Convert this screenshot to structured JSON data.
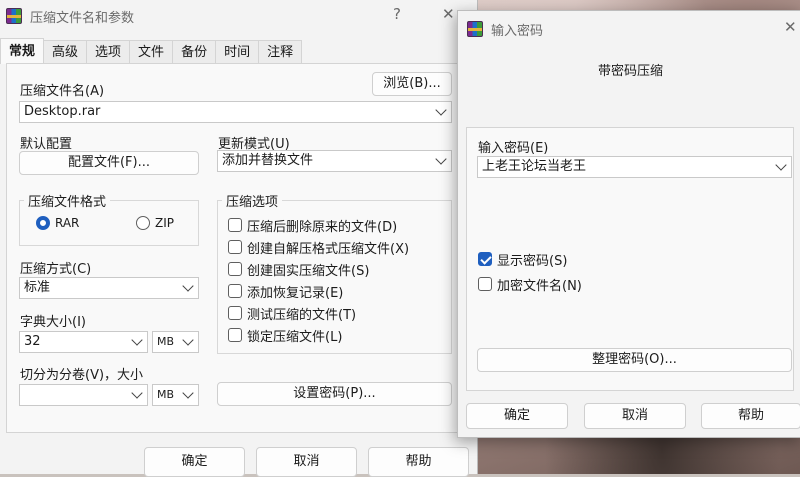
{
  "main_dialog": {
    "title": "压缩文件名和参数",
    "help_glyph": "?",
    "close_glyph": "✕",
    "tabs": [
      "常规",
      "高级",
      "选项",
      "文件",
      "备份",
      "时间",
      "注释"
    ],
    "archive_name_label": "压缩文件名(A)",
    "browse_button": "浏览(B)...",
    "archive_name_value": "Desktop.rar",
    "default_profile_label": "默认配置",
    "profile_button": "配置文件(F)...",
    "update_mode_label": "更新模式(U)",
    "update_mode_value": "添加并替换文件",
    "format_group_title": "压缩文件格式",
    "format_rar": "RAR",
    "format_zip": "ZIP",
    "options_group_title": "压缩选项",
    "options": [
      {
        "label": "压缩后删除原来的文件(D)",
        "checked": false
      },
      {
        "label": "创建自解压格式压缩文件(X)",
        "checked": false
      },
      {
        "label": "创建固实压缩文件(S)",
        "checked": false
      },
      {
        "label": "添加恢复记录(E)",
        "checked": false
      },
      {
        "label": "测试压缩的文件(T)",
        "checked": false
      },
      {
        "label": "锁定压缩文件(L)",
        "checked": false
      }
    ],
    "method_label": "压缩方式(C)",
    "method_value": "标准",
    "dict_label": "字典大小(I)",
    "dict_value": "32",
    "dict_unit": "MB",
    "split_label": "切分为分卷(V)，大小",
    "split_value": "",
    "split_unit": "MB",
    "set_password_button": "设置密码(P)...",
    "ok_button": "确定",
    "cancel_button": "取消",
    "help_button": "帮助"
  },
  "password_dialog": {
    "title": "输入密码",
    "close_glyph": "✕",
    "heading": "带密码压缩",
    "enter_password_label": "输入密码(E)",
    "password_value": "上老王论坛当老王",
    "show_password_label": "显示密码(S)",
    "show_password_checked": true,
    "encrypt_names_label": "加密文件名(N)",
    "encrypt_names_checked": false,
    "organize_button": "整理密码(O)...",
    "ok_button": "确定",
    "cancel_button": "取消",
    "help_button": "帮助"
  }
}
